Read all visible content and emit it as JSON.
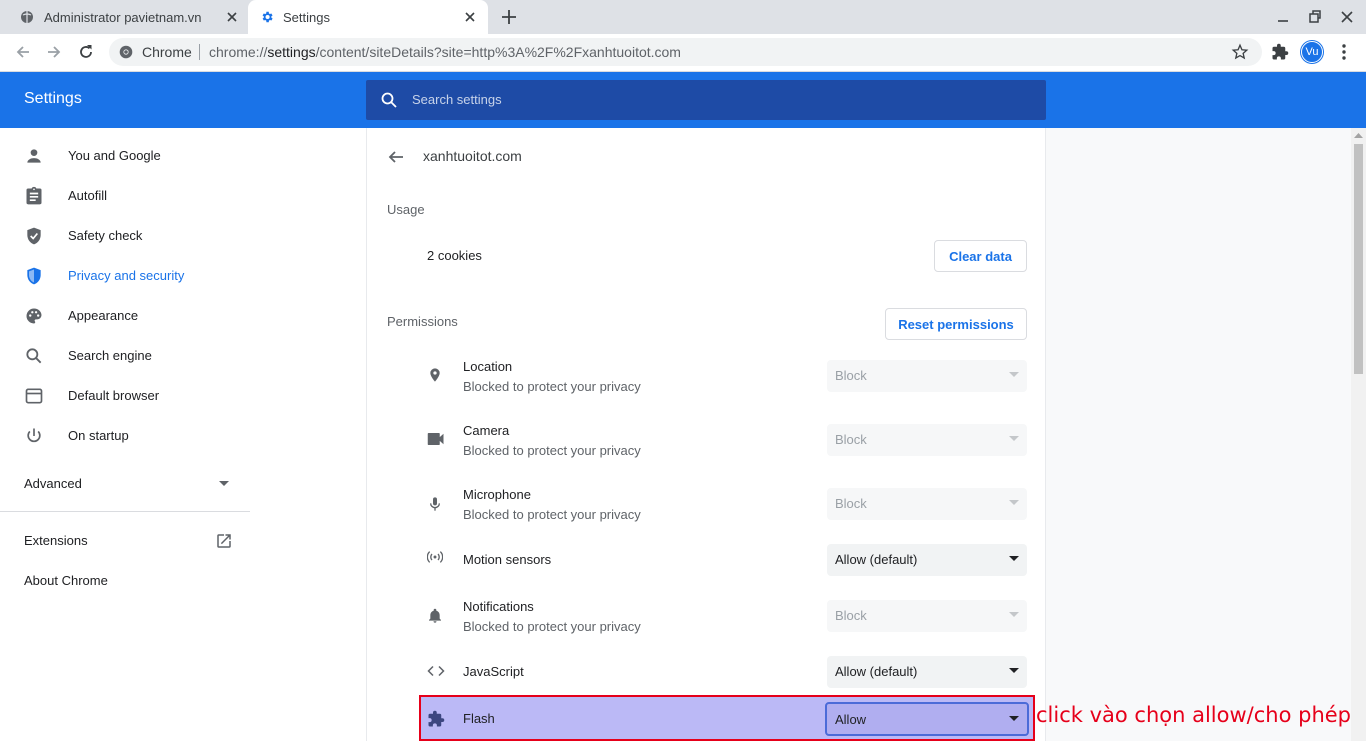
{
  "tabs": [
    {
      "title": "Administrator pavietnam.vn",
      "active": false
    },
    {
      "title": "Settings",
      "active": true
    }
  ],
  "toolbar": {
    "omnibox_label": "Chrome",
    "url_prefix": "chrome://",
    "url_host": "settings",
    "url_path": "/content/siteDetails?site=http%3A%2F%2Fxanhtuoitot.com",
    "profile_initials": "Vu"
  },
  "header": {
    "title": "Settings",
    "search_placeholder": "Search settings"
  },
  "sidebar": {
    "items": [
      {
        "label": "You and Google",
        "icon": "person-icon",
        "active": false
      },
      {
        "label": "Autofill",
        "icon": "clipboard-icon",
        "active": false
      },
      {
        "label": "Safety check",
        "icon": "shield-check-icon",
        "active": false
      },
      {
        "label": "Privacy and security",
        "icon": "shield-icon",
        "active": true
      },
      {
        "label": "Appearance",
        "icon": "palette-icon",
        "active": false
      },
      {
        "label": "Search engine",
        "icon": "search-icon",
        "active": false
      },
      {
        "label": "Default browser",
        "icon": "browser-icon",
        "active": false
      },
      {
        "label": "On startup",
        "icon": "power-icon",
        "active": false
      }
    ],
    "advanced_label": "Advanced",
    "extensions_label": "Extensions",
    "about_label": "About Chrome"
  },
  "site": {
    "name": "xanhtuoitot.com",
    "usage_label": "Usage",
    "cookies_text": "2 cookies",
    "clear_data_label": "Clear data",
    "permissions_label": "Permissions",
    "reset_permissions_label": "Reset permissions"
  },
  "permissions": [
    {
      "name": "Location",
      "sub": "Blocked to protect your privacy",
      "value": "Block",
      "disabled": true,
      "icon": "location-pin-icon"
    },
    {
      "name": "Camera",
      "sub": "Blocked to protect your privacy",
      "value": "Block",
      "disabled": true,
      "icon": "camera-icon"
    },
    {
      "name": "Microphone",
      "sub": "Blocked to protect your privacy",
      "value": "Block",
      "disabled": true,
      "icon": "microphone-icon"
    },
    {
      "name": "Motion sensors",
      "sub": "",
      "value": "Allow (default)",
      "disabled": false,
      "icon": "motion-sensor-icon"
    },
    {
      "name": "Notifications",
      "sub": "Blocked to protect your privacy",
      "value": "Block",
      "disabled": true,
      "icon": "bell-icon"
    },
    {
      "name": "JavaScript",
      "sub": "",
      "value": "Allow (default)",
      "disabled": false,
      "icon": "code-icon"
    },
    {
      "name": "Flash",
      "sub": "",
      "value": "Allow",
      "disabled": false,
      "icon": "puzzle-icon"
    }
  ],
  "annotation": "click vào chọn allow/cho phép",
  "colors": {
    "accent": "#1a73e8",
    "header_bg": "#1a73e8",
    "search_bg": "#1e4ba6",
    "highlight_border": "#e6001a",
    "highlight_fill": "#bbb9f6"
  }
}
